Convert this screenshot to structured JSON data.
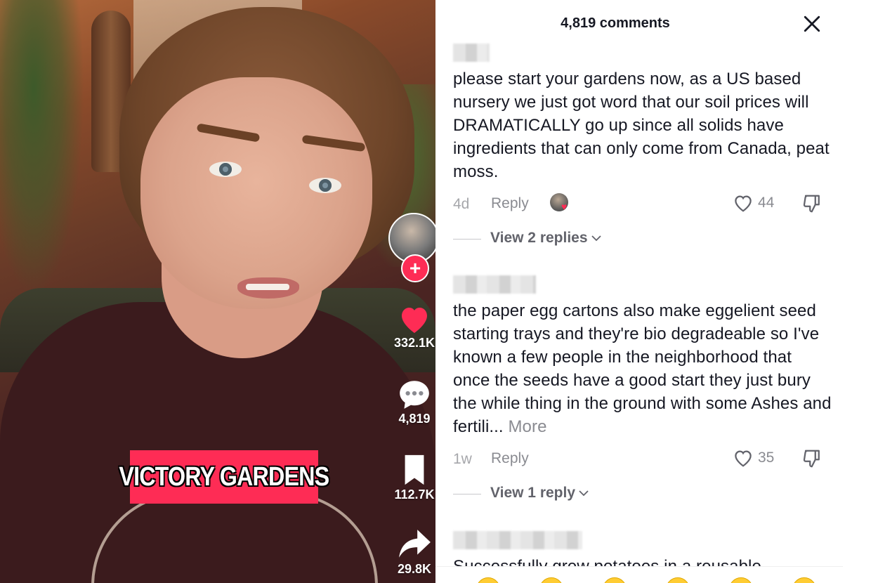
{
  "video": {
    "caption": "VICTORY GARDENS",
    "actions": {
      "likes": "332.1K",
      "comments": "4,819",
      "saves": "112.7K",
      "shares": "29.8K"
    },
    "follow_symbol": "+"
  },
  "comments_panel": {
    "title": "4,819 comments",
    "close_glyph": "✕",
    "items": [
      {
        "text": "please start your gardens now, as a US based nursery we just got word that our soil prices will DRAMATICALLY go up since all solids have ingredients that can only come from Canada, peat moss.",
        "time": "4d",
        "reply_label": "Reply",
        "likes": "44",
        "replies_label": "View 2 replies",
        "creator_liked": true
      },
      {
        "text": "the paper egg cartons also make eggelient seed starting trays and they're bio degradeable so I've known a few people in the neighborhood that once the seeds have a good start they just bury the while thing in the ground with some Ashes and fertili...",
        "more_label": "More",
        "time": "1w",
        "reply_label": "Reply",
        "likes": "35",
        "replies_label": "View 1 reply"
      },
      {
        "text": "Successfully grew potatoes in a reusable"
      }
    ]
  },
  "colors": {
    "accent": "#fe2c55",
    "text_primary": "#161823",
    "text_secondary": "#8a8b91"
  },
  "icons": [
    "heart-icon",
    "comment-icon",
    "bookmark-icon",
    "share-icon",
    "close-icon",
    "like-heart-icon",
    "dislike-icon",
    "chevron-down-icon"
  ]
}
